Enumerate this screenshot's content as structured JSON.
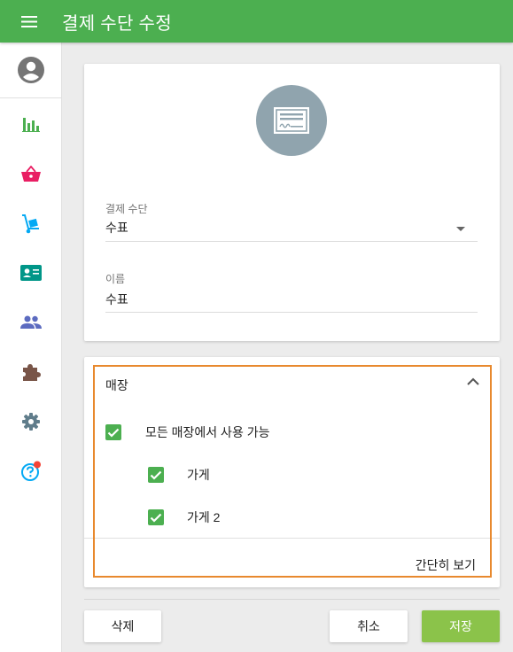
{
  "appbar": {
    "title": "결제 수단 수정",
    "icon": "hamburger-menu-icon",
    "color": "#4caf50"
  },
  "sidebar": {
    "avatar_icon": "account-circle-icon",
    "items": [
      {
        "name": "reports",
        "icon": "bar-chart-icon",
        "color": "#4caf50"
      },
      {
        "name": "items",
        "icon": "shopping-basket-icon",
        "color": "#e91e63"
      },
      {
        "name": "inventory",
        "icon": "hand-truck-icon",
        "color": "#03a9f4"
      },
      {
        "name": "employees",
        "icon": "id-card-icon",
        "color": "#009688"
      },
      {
        "name": "customers",
        "icon": "people-icon",
        "color": "#5c6bc0"
      },
      {
        "name": "integrations",
        "icon": "puzzle-icon",
        "color": "#795548"
      },
      {
        "name": "settings",
        "icon": "gear-icon",
        "color": "#607d8b"
      },
      {
        "name": "help",
        "icon": "help-circle-icon",
        "color": "#03a9f4",
        "badge_color": "#f44336"
      }
    ]
  },
  "form": {
    "payment_icon": "check-payment-icon",
    "payment_type": {
      "label": "결제 수단",
      "value": "수표"
    },
    "name": {
      "label": "이름",
      "value": "수표"
    }
  },
  "stores": {
    "title": "매장",
    "all_label": "모든 매장에서 사용 가능",
    "all_checked": true,
    "list": [
      {
        "label": "가게",
        "checked": true
      },
      {
        "label": "가게 2",
        "checked": true
      }
    ],
    "show_less": "간단히 보기"
  },
  "actions": {
    "delete": "삭제",
    "cancel": "취소",
    "save": "저장"
  }
}
